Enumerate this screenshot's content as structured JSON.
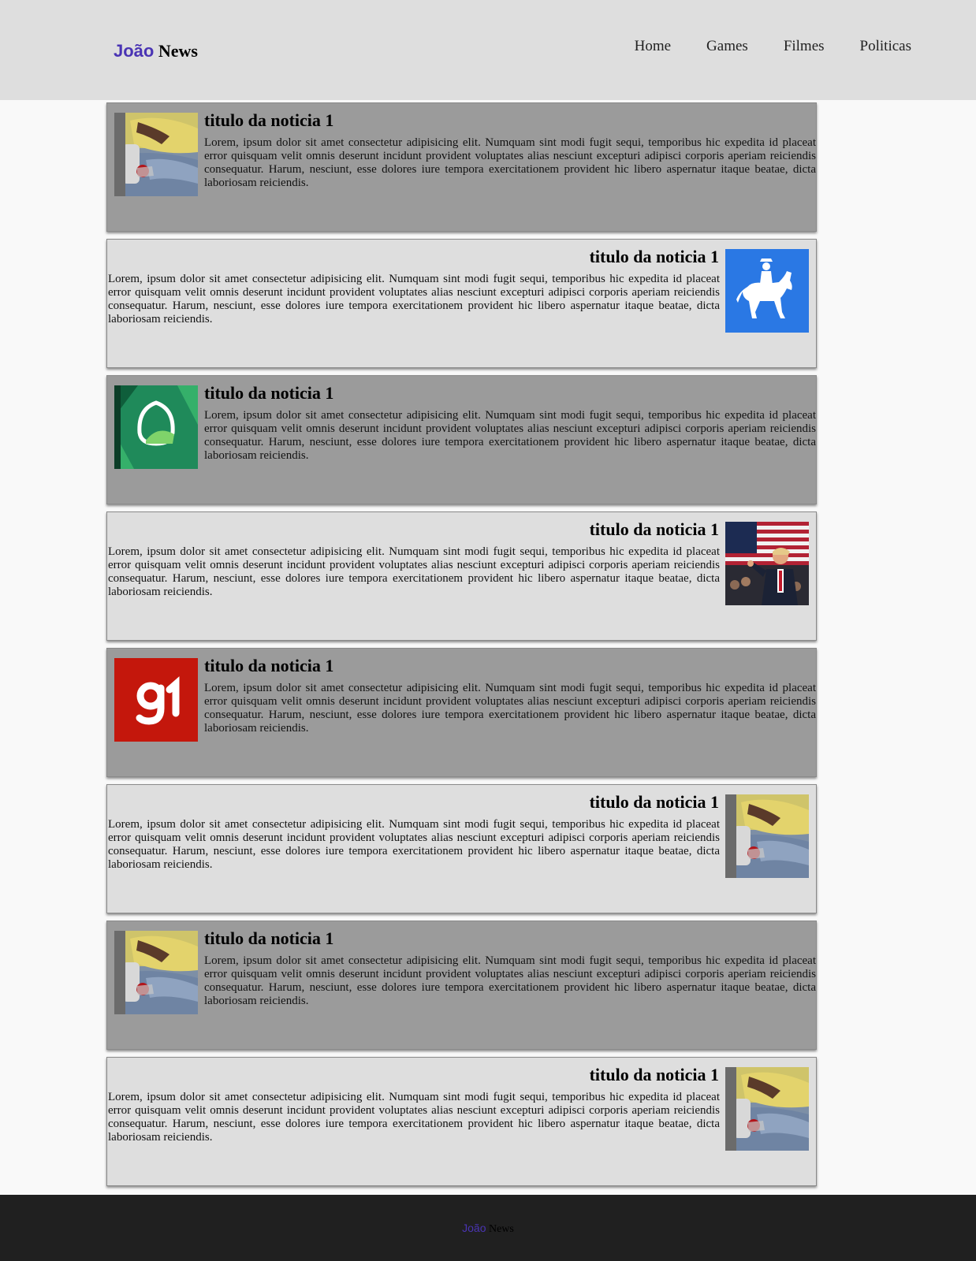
{
  "header": {
    "logo_first": "João",
    "logo_second": "News",
    "nav": [
      "Home",
      "Games",
      "Filmes",
      "Politicas"
    ]
  },
  "articles": [
    {
      "title": "titulo da noticia 1",
      "body": "Lorem, ipsum dolor sit amet consectetur adipisicing elit. Numquam sint modi fugit sequi, temporibus hic expedita id placeat error quisquam velit omnis deserunt incidunt provident voluptates alias nesciunt excepturi adipisci corporis aperiam reiciendis consequatur. Harum, nesciunt, esse dolores iure tempora exercitationem provident hic libero aspernatur itaque beatae, dicta laboriosam reiciendis.",
      "image": "blood-donation-photo"
    },
    {
      "title": "titulo da noticia 1",
      "body": "Lorem, ipsum dolor sit amet consectetur adipisicing elit. Numquam sint modi fugit sequi, temporibus hic expedita id placeat error quisquam velit omnis deserunt incidunt provident voluptates alias nesciunt excepturi adipisci corporis aperiam reiciendis consequatur. Harum, nesciunt, esse dolores iure tempora exercitationem provident hic libero aspernatur itaque beatae, dicta laboriosam reiciendis.",
      "image": "horse-rider-logo"
    },
    {
      "title": "titulo da noticia 1",
      "body": "Lorem, ipsum dolor sit amet consectetur adipisicing elit. Numquam sint modi fugit sequi, temporibus hic expedita id placeat error quisquam velit omnis deserunt incidunt provident voluptates alias nesciunt excepturi adipisci corporis aperiam reiciendis consequatur. Harum, nesciunt, esse dolores iure tempora exercitationem provident hic libero aspernatur itaque beatae, dicta laboriosam reiciendis.",
      "image": "pao-de-acucar-logo"
    },
    {
      "title": "titulo da noticia 1",
      "body": "Lorem, ipsum dolor sit amet consectetur adipisicing elit. Numquam sint modi fugit sequi, temporibus hic expedita id placeat error quisquam velit omnis deserunt incidunt provident voluptates alias nesciunt excepturi adipisci corporis aperiam reiciendis consequatur. Harum, nesciunt, esse dolores iure tempora exercitationem provident hic libero aspernatur itaque beatae, dicta laboriosam reiciendis.",
      "image": "politician-flag-photo"
    },
    {
      "title": "titulo da noticia 1",
      "body": "Lorem, ipsum dolor sit amet consectetur adipisicing elit. Numquam sint modi fugit sequi, temporibus hic expedita id placeat error quisquam velit omnis deserunt incidunt provident voluptates alias nesciunt excepturi adipisci corporis aperiam reiciendis consequatur. Harum, nesciunt, esse dolores iure tempora exercitationem provident hic libero aspernatur itaque beatae, dicta laboriosam reiciendis.",
      "image": "g1-logo"
    },
    {
      "title": "titulo da noticia 1",
      "body": "Lorem, ipsum dolor sit amet consectetur adipisicing elit. Numquam sint modi fugit sequi, temporibus hic expedita id placeat error quisquam velit omnis deserunt incidunt provident voluptates alias nesciunt excepturi adipisci corporis aperiam reiciendis consequatur. Harum, nesciunt, esse dolores iure tempora exercitationem provident hic libero aspernatur itaque beatae, dicta laboriosam reiciendis.",
      "image": "blood-donation-photo"
    },
    {
      "title": "titulo da noticia 1",
      "body": "Lorem, ipsum dolor sit amet consectetur adipisicing elit. Numquam sint modi fugit sequi, temporibus hic expedita id placeat error quisquam velit omnis deserunt incidunt provident voluptates alias nesciunt excepturi adipisci corporis aperiam reiciendis consequatur. Harum, nesciunt, esse dolores iure tempora exercitationem provident hic libero aspernatur itaque beatae, dicta laboriosam reiciendis.",
      "image": "blood-donation-photo"
    },
    {
      "title": "titulo da noticia 1",
      "body": "Lorem, ipsum dolor sit amet consectetur adipisicing elit. Numquam sint modi fugit sequi, temporibus hic expedita id placeat error quisquam velit omnis deserunt incidunt provident voluptates alias nesciunt excepturi adipisci corporis aperiam reiciendis consequatur. Harum, nesciunt, esse dolores iure tempora exercitationem provident hic libero aspernatur itaque beatae, dicta laboriosam reiciendis.",
      "image": "blood-donation-photo"
    }
  ],
  "footer": {
    "logo_first": "João",
    "logo_second": "News"
  },
  "colors": {
    "brand": "#4a34b4",
    "header_bg": "#dedede",
    "card_dark": "#9b9b9b",
    "card_light": "#dedede",
    "footer_bg": "#202020",
    "g1_red": "#c4170c",
    "rider_blue": "#2a78e4"
  }
}
